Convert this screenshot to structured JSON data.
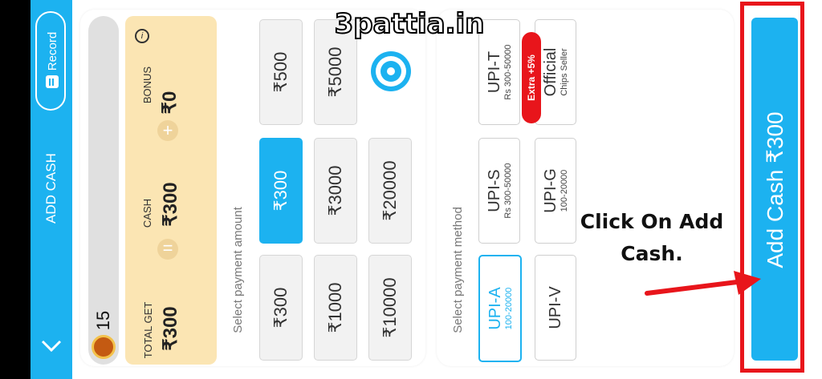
{
  "sidebar": {
    "record_label": "Record",
    "title": "ADD CASH"
  },
  "bonus_card": {
    "coins": "15",
    "total_label": "TOTAL GET",
    "total_value": "₹300",
    "cash_label": "CASH",
    "cash_value": "₹300",
    "bonus_label": "BONUS",
    "bonus_value": "₹0",
    "equals_symbol": "=",
    "plus_symbol": "+",
    "info_symbol": "i"
  },
  "amount_section": {
    "label": "Select payment amount",
    "amounts": [
      "₹300",
      "₹1000",
      "₹10000",
      "₹300",
      "₹3000",
      "₹20000",
      "₹500",
      "₹5000"
    ],
    "selected": "₹300"
  },
  "method_section": {
    "label": "Select payment method",
    "methods": [
      {
        "name": "UPI-A",
        "range": "100-20000"
      },
      {
        "name": "UPI-V",
        "range": ""
      },
      {
        "name": "UPI-S",
        "range": "Rs 300-50000"
      },
      {
        "name": "UPI-G",
        "range": "100-20000"
      },
      {
        "name": "UPI-T",
        "range": "Rs 300-50000"
      },
      {
        "name": "Official",
        "range": "Chips Seller",
        "badge": "Extra +5%"
      }
    ],
    "selected": "UPI-A"
  },
  "cta": {
    "label": "Add Cash ₹300"
  },
  "overlay": {
    "watermark": "3pattia.in",
    "instruction": "Click On Add Cash."
  },
  "colors": {
    "accent": "#1cb2f0",
    "highlight": "#e8151b",
    "card": "#fbe5b3"
  }
}
